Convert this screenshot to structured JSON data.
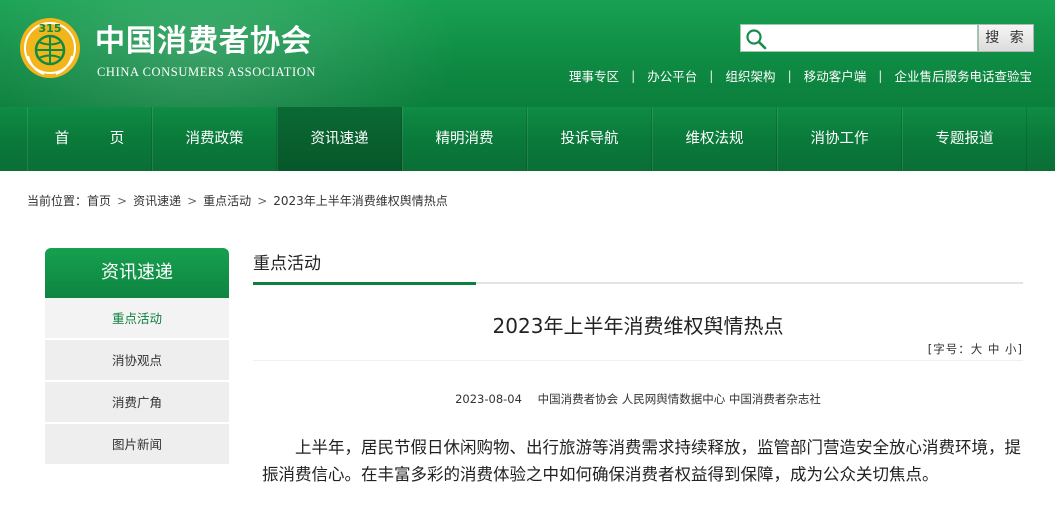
{
  "header": {
    "title": "中国消费者协会",
    "subtitle": "CHINA CONSUMERS ASSOCIATION",
    "logo_text": "315",
    "search": {
      "placeholder": "",
      "button_label": "搜 索"
    },
    "top_links": [
      "理事专区",
      "办公平台",
      "组织架构",
      "移动客户端",
      "企业售后服务电话查验宝"
    ]
  },
  "nav": {
    "items": [
      {
        "label": "首 页",
        "active": false
      },
      {
        "label": "消费政策",
        "active": false
      },
      {
        "label": "资讯速递",
        "active": true
      },
      {
        "label": "精明消费",
        "active": false
      },
      {
        "label": "投诉导航",
        "active": false
      },
      {
        "label": "维权法规",
        "active": false
      },
      {
        "label": "消协工作",
        "active": false
      },
      {
        "label": "专题报道",
        "active": false
      }
    ]
  },
  "breadcrumb": {
    "prefix": "当前位置：",
    "items": [
      "首页",
      "资讯速递",
      "重点活动",
      "2023年上半年消费维权舆情热点"
    ],
    "separator": ">"
  },
  "sidebar": {
    "title": "资讯速递",
    "items": [
      {
        "label": "重点活动",
        "active": true
      },
      {
        "label": "消协观点",
        "active": false
      },
      {
        "label": "消费广角",
        "active": false
      },
      {
        "label": "图片新闻",
        "active": false
      }
    ]
  },
  "main": {
    "section_title": "重点活动",
    "article_title": "2023年上半年消费维权舆情热点",
    "font_size_control": "[字号：大 中 小]",
    "date": "2023-08-04",
    "sources": "中国消费者协会 人民网舆情数据中心 中国消费者杂志社",
    "body": "上半年，居民节假日休闲购物、出行旅游等消费需求持续释放，监管部门营造安全放心消费环境，提振消费信心。在丰富多彩的消费体验之中如何确保消费者权益得到保障，成为公众关切焦点。"
  },
  "colors": {
    "brand_green": "#0e8a43",
    "nav_active": "#06572a",
    "accent_link": "#0b7f3c",
    "logo_gold": "#f2b51c"
  }
}
